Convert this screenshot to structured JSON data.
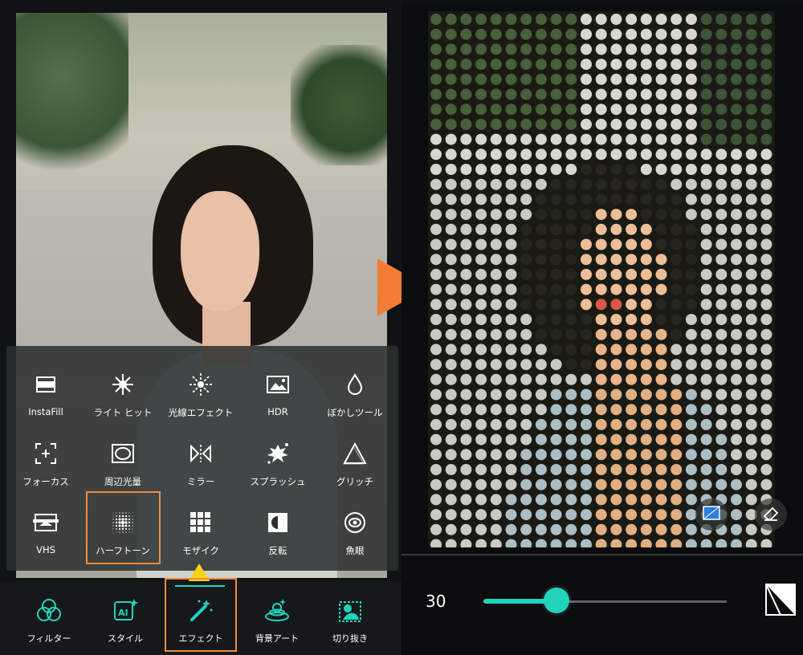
{
  "tools": [
    {
      "label": "InstaFill",
      "icon": "instafill-icon"
    },
    {
      "label": "ライト ヒット",
      "icon": "light-hit-icon"
    },
    {
      "label": "光線エフェクト",
      "icon": "light-ray-icon"
    },
    {
      "label": "HDR",
      "icon": "hdr-icon"
    },
    {
      "label": "ぼかしツール",
      "icon": "blur-drop-icon"
    },
    {
      "label": "フォーカス",
      "icon": "focus-icon"
    },
    {
      "label": "周辺光量",
      "icon": "vignette-icon"
    },
    {
      "label": "ミラー",
      "icon": "mirror-icon"
    },
    {
      "label": "スプラッシュ",
      "icon": "splash-icon"
    },
    {
      "label": "グリッチ",
      "icon": "glitch-icon"
    },
    {
      "label": "VHS",
      "icon": "vhs-icon"
    },
    {
      "label": "ハーフトーン",
      "icon": "halftone-icon"
    },
    {
      "label": "モザイク",
      "icon": "mosaic-icon"
    },
    {
      "label": "反転",
      "icon": "invert-icon"
    },
    {
      "label": "魚眼",
      "icon": "fisheye-icon"
    }
  ],
  "selected_tool": "ハーフトーン",
  "bottom_tabs": [
    {
      "label": "フィルター",
      "icon": "filter-circles-icon"
    },
    {
      "label": "スタイル",
      "icon": "ai-style-icon"
    },
    {
      "label": "エフェクト",
      "icon": "magic-wand-icon"
    },
    {
      "label": "背景アート",
      "icon": "background-art-icon"
    },
    {
      "label": "切り抜き",
      "icon": "cutout-icon"
    }
  ],
  "selected_tab": "エフェクト",
  "slider": {
    "value_label": "30",
    "value": 30,
    "max": 100
  },
  "colors": {
    "accent": "#22d3bb",
    "highlight": "#f28c3c",
    "arrow": "#f6d21c",
    "play": "#f27d35"
  }
}
